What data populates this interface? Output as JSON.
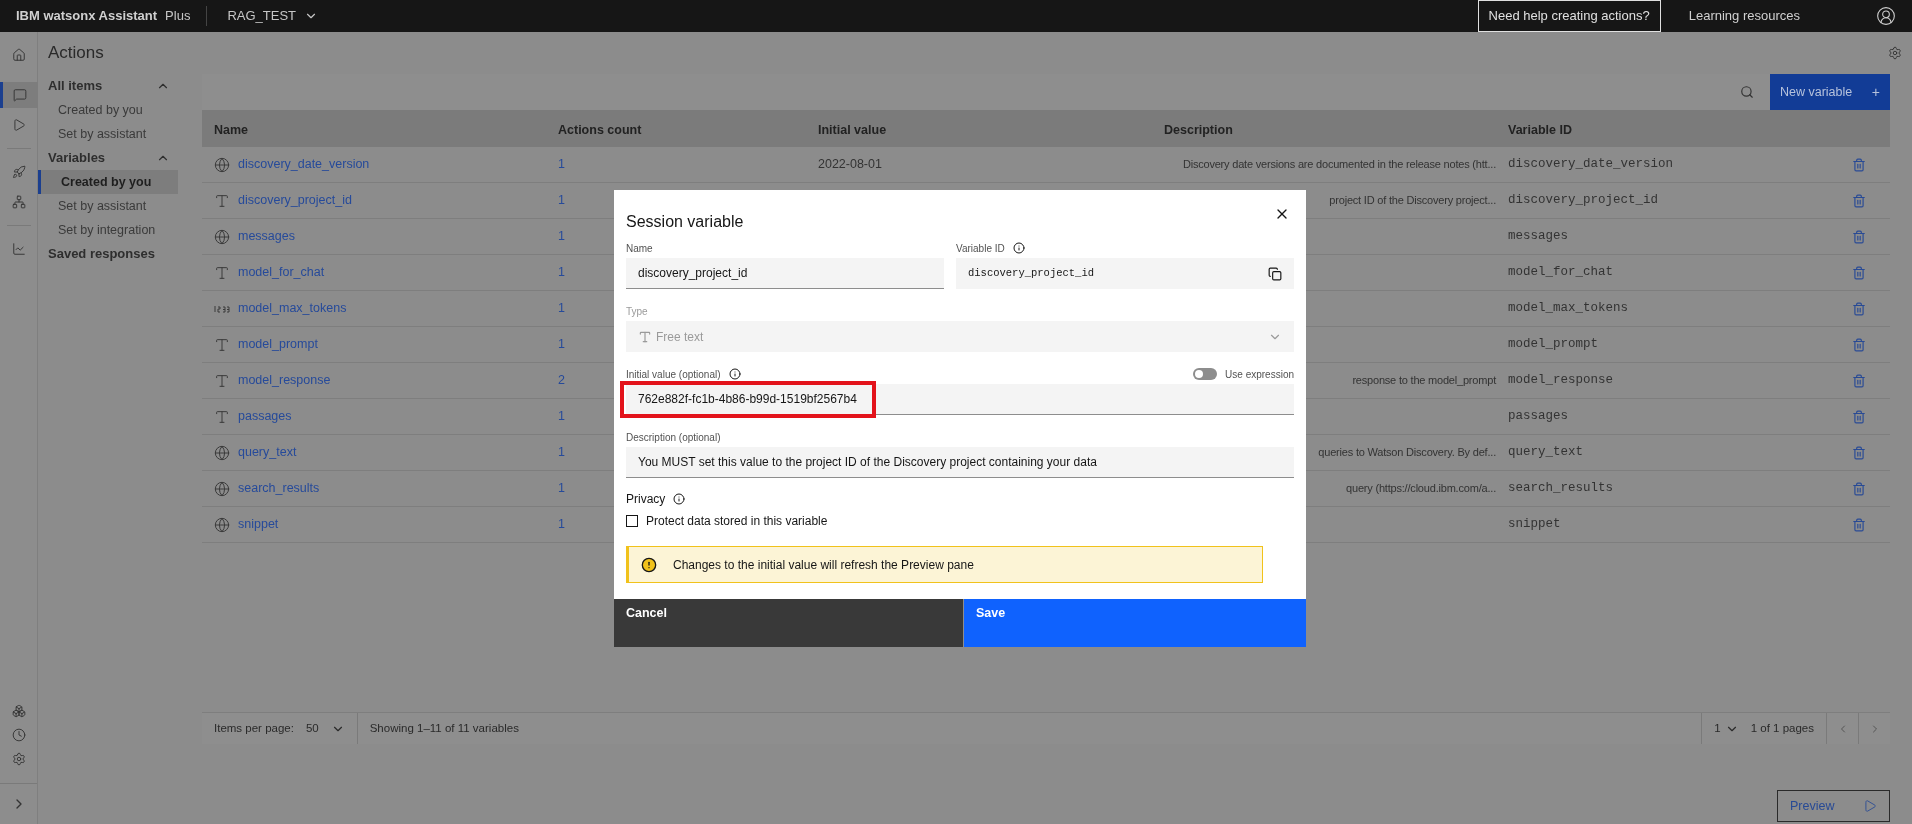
{
  "top_bar": {
    "product": "IBM watsonx Assistant",
    "plan": "Plus",
    "assistant": "RAG_TEST",
    "help": "Need help creating actions?",
    "resources": "Learning resources"
  },
  "rail": [
    {
      "selected": false
    },
    {
      "selected": true
    },
    {
      "selected": false
    },
    {
      "selected": false
    },
    {
      "selected": false
    },
    {
      "selected": false
    }
  ],
  "page_title": "Actions",
  "sidebar": [
    {
      "label": "All items",
      "expanded": true,
      "children": [
        {
          "label": "Created by you",
          "selected": false
        },
        {
          "label": "Set by assistant",
          "selected": false
        }
      ]
    },
    {
      "label": "Variables",
      "expanded": true,
      "children": [
        {
          "label": "Created by you",
          "selected": true
        },
        {
          "label": "Set by assistant",
          "selected": false
        },
        {
          "label": "Set by integration",
          "selected": false
        }
      ]
    },
    {
      "label": "Saved responses",
      "expanded": false
    }
  ],
  "toolbar": {
    "new_button": "New variable",
    "new_icon": "+"
  },
  "table": {
    "columns": [
      "Name",
      "Actions count",
      "Initial value",
      "Description",
      "Variable ID"
    ],
    "rows": [
      {
        "kind": "globe",
        "name": "discovery_date_version",
        "count": "1",
        "initial": "2022-08-01",
        "description": "Discovery date versions are documented in the release notes (htt...",
        "id": "discovery_date_version"
      },
      {
        "kind": "text",
        "name": "discovery_project_id",
        "count": "1",
        "description": "project ID of the Discovery project...",
        "id": "discovery_project_id"
      },
      {
        "kind": "globe",
        "name": "messages",
        "count": "1",
        "id": "messages"
      },
      {
        "kind": "text",
        "name": "model_for_chat",
        "count": "1",
        "id": "model_for_chat"
      },
      {
        "kind": "number",
        "name": "model_max_tokens",
        "count": "1",
        "id": "model_max_tokens"
      },
      {
        "kind": "text",
        "name": "model_prompt",
        "count": "1",
        "id": "model_prompt"
      },
      {
        "kind": "text",
        "name": "model_response",
        "count": "2",
        "description": "response to the model_prompt",
        "id": "model_response"
      },
      {
        "kind": "text",
        "name": "passages",
        "count": "1",
        "id": "passages"
      },
      {
        "kind": "globe",
        "name": "query_text",
        "count": "1",
        "description": "queries to Watson Discovery. By def...",
        "id": "query_text"
      },
      {
        "kind": "globe",
        "name": "search_results",
        "count": "1",
        "description": "query (https://cloud.ibm.com/a...",
        "id": "search_results"
      },
      {
        "kind": "globe",
        "name": "snippet",
        "count": "1",
        "id": "snippet"
      }
    ]
  },
  "pagination": {
    "items_label": "Items per page:",
    "items_value": "50",
    "showing": "Showing 1–11 of 11 variables",
    "page": "1",
    "pages": "1 of 1 pages"
  },
  "preview_button": "Preview",
  "modal": {
    "title": "Session variable",
    "name_label": "Name",
    "name_value": "discovery_project_id",
    "id_label": "Variable ID",
    "id_value": "discovery_project_id",
    "type_label": "Type",
    "type_value": "Free text",
    "type_disabled": true,
    "initial_label": "Initial value (optional)",
    "expression_label": "Use expression",
    "expression_on": false,
    "initial_value": "762e882f-fc1b-4b86-b99d-1519bf2567b4",
    "highlighted": true,
    "description_label": "Description (optional)",
    "description_value": "You MUST set this value to the project ID of the Discovery project containing your data",
    "privacy_label": "Privacy",
    "protect_label": "Protect data stored in this variable",
    "protect_checked": false,
    "notice": "Changes to the initial value will refresh the Preview pane",
    "cancel": "Cancel",
    "save": "Save"
  }
}
